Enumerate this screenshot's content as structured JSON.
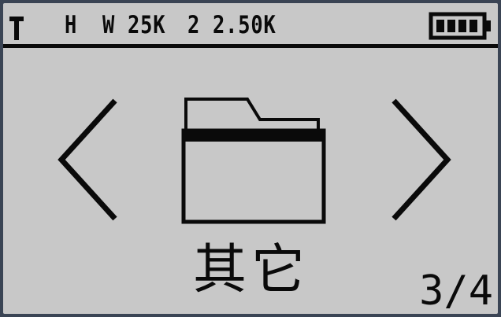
{
  "status_bar": {
    "mode": "H",
    "channel": "W",
    "value_1": "25K",
    "value_2": "2",
    "value_3": "2.50K",
    "signal_icon": "antenna-icon",
    "battery_icon": "battery-full-icon",
    "battery_level": 1.0
  },
  "menu": {
    "current_item_label": "其它",
    "current_item_icon": "folder-icon",
    "prev_icon": "chevron-left-icon",
    "next_icon": "chevron-right-icon",
    "page": "3/4"
  },
  "colors": {
    "screen_background": "#c8c8c8",
    "foreground": "#0a0a0a",
    "bezel": "#3a4454"
  }
}
